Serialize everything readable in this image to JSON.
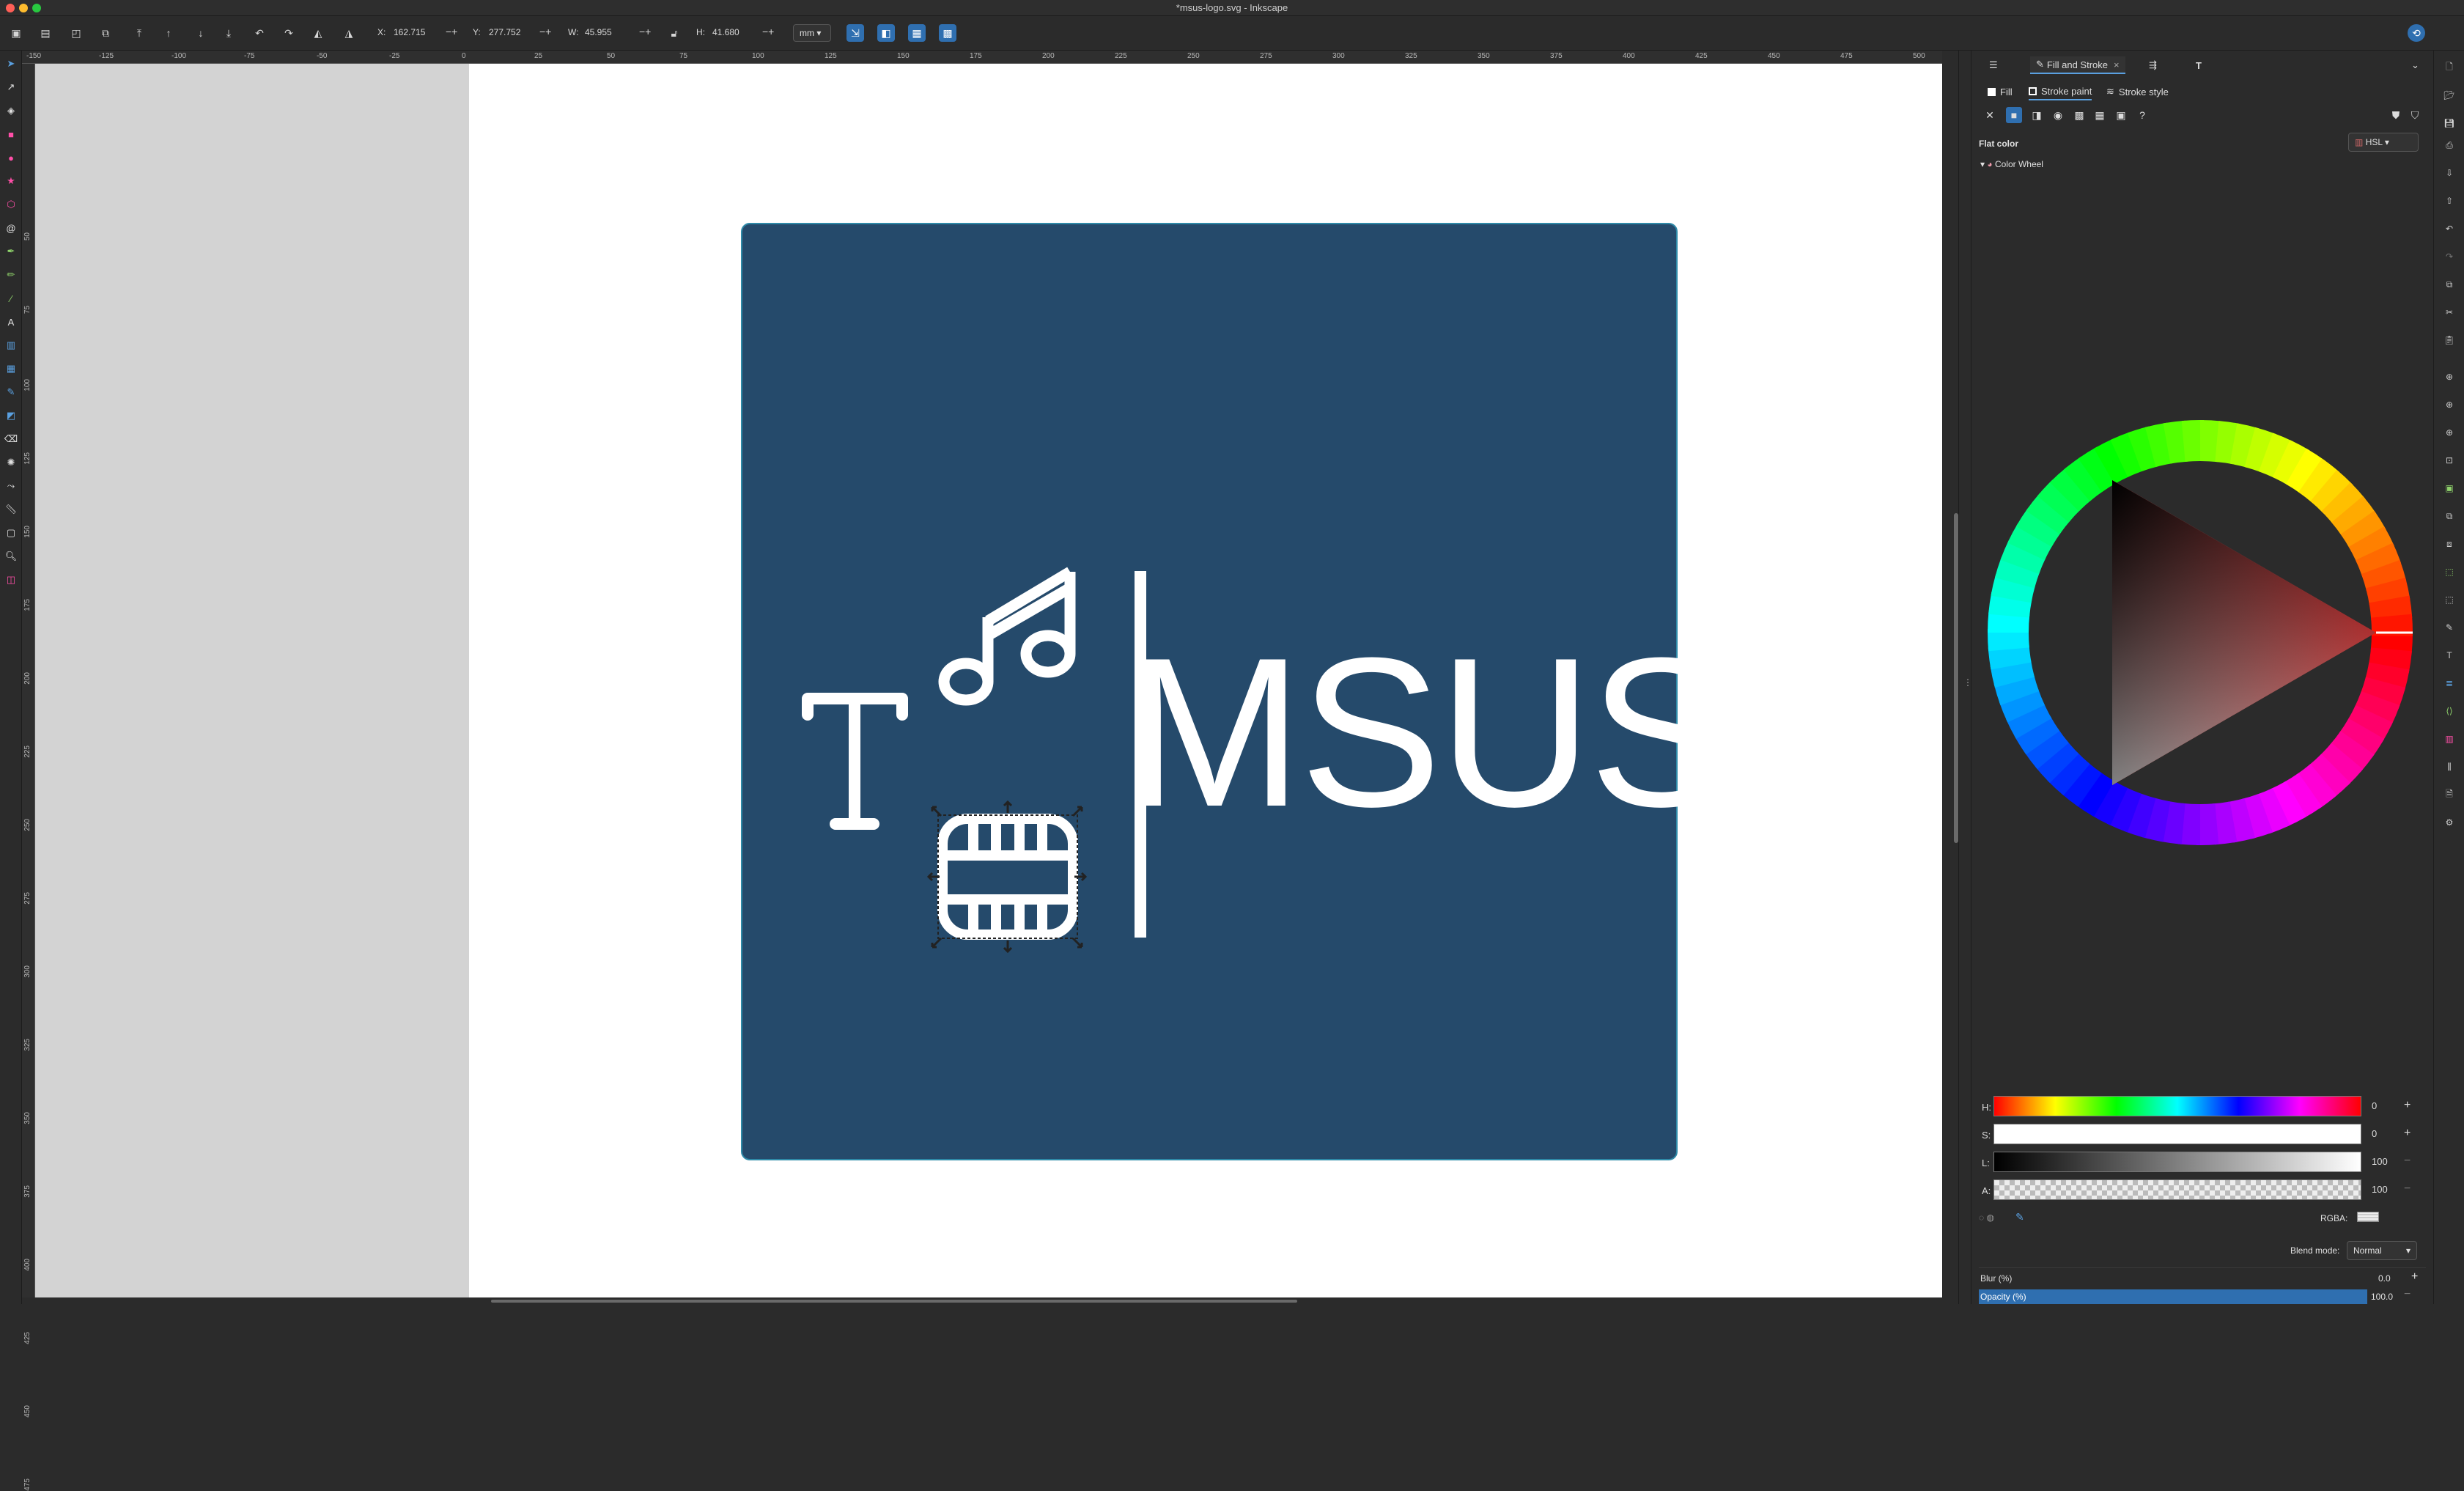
{
  "window": {
    "title": "*msus-logo.svg - Inkscape"
  },
  "toolbar": {
    "x_label": "X:",
    "x_value": "162.715",
    "y_label": "Y:",
    "y_value": "277.752",
    "w_label": "W:",
    "w_value": "45.955",
    "h_label": "H:",
    "h_value": "41.680",
    "unit": "mm"
  },
  "ruler": {
    "h_ticks": [
      "-150",
      "-125",
      "-100",
      "-75",
      "-50",
      "-25",
      "0",
      "25",
      "50",
      "75",
      "100",
      "125",
      "150",
      "175",
      "200",
      "225",
      "250",
      "275",
      "300",
      "325",
      "350",
      "375",
      "400",
      "425",
      "450",
      "475",
      "500"
    ],
    "v_ticks": [
      "50",
      "75",
      "100",
      "125",
      "150",
      "175",
      "200",
      "225",
      "250",
      "275",
      "300",
      "325",
      "350",
      "375",
      "400",
      "425",
      "450",
      "475"
    ]
  },
  "canvas": {
    "logo_text": "MSUS",
    "logo_bg_color": "#254a6b",
    "logo_fg_color": "#ffffff"
  },
  "panel": {
    "tab_fill_stroke": "Fill and Stroke",
    "subtab_fill": "Fill",
    "subtab_stroke_paint": "Stroke paint",
    "subtab_stroke_style": "Stroke style",
    "mode_label": "Flat color",
    "color_model": "HSL",
    "wheel_label": "Color Wheel",
    "h_label": "H:",
    "h_value": "0",
    "s_label": "S:",
    "s_value": "0",
    "l_label": "L:",
    "l_value": "100",
    "a_label": "A:",
    "a_value": "100",
    "rgba_label": "RGBA:",
    "blend_label": "Blend mode:",
    "blend_value": "Normal",
    "blur_label": "Blur (%)",
    "blur_value": "0.0",
    "opacity_label": "Opacity (%)",
    "opacity_value": "100.0",
    "accent_color": "#2f6fb0"
  }
}
